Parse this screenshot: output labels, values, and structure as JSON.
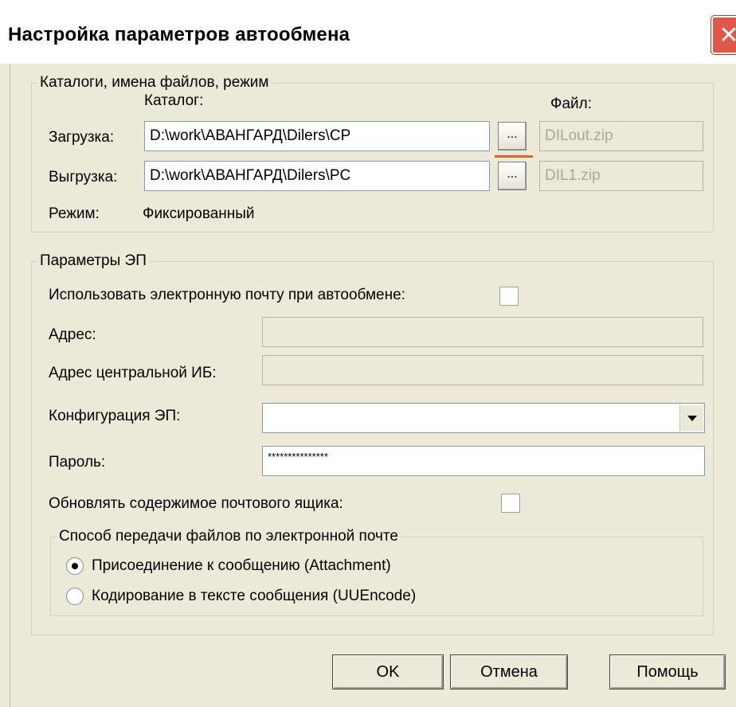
{
  "window": {
    "title": "Настройка параметров автообмена",
    "close_icon": "close-icon"
  },
  "catalogs": {
    "legend": "Каталоги, имена файлов, режим",
    "catalog_header": "Каталог:",
    "file_header": "Файл:",
    "load_label": "Загрузка:",
    "load_path": "D:\\work\\АВАНГАРД\\Dilers\\CP",
    "load_file": "DILout.zip",
    "unload_label": "Выгрузка:",
    "unload_path": "D:\\work\\АВАНГАРД\\Dilers\\PC",
    "unload_file": "DIL1.zip",
    "browse_label": "...",
    "mode_label": "Режим:",
    "mode_value": "Фиксированный"
  },
  "email": {
    "legend": "Параметры ЭП",
    "use_email_label": "Использовать электронную почту при автообмене:",
    "use_email_checked": false,
    "address_label": "Адрес:",
    "address_value": "",
    "central_address_label": "Адрес центральной ИБ:",
    "central_address_value": "",
    "config_label": "Конфигурация ЭП:",
    "config_value": "",
    "password_label": "Пароль:",
    "password_value": "***************",
    "refresh_mailbox_label": "Обновлять содержимое почтового ящика:",
    "refresh_mailbox_checked": false,
    "transfer": {
      "legend": "Способ передачи файлов по электронной почте",
      "option_attachment": "Присоединение к сообщению (Attachment)",
      "option_uuencode": "Кодирование в тексте сообщения (UUEncode)",
      "selected": "attachment"
    }
  },
  "buttons": {
    "ok": "OK",
    "cancel": "Отмена",
    "help": "Помощь"
  },
  "colors": {
    "dialog_bg": "#ece9d8",
    "accent_underline": "#e2631f",
    "close_button": "#e0574a"
  }
}
